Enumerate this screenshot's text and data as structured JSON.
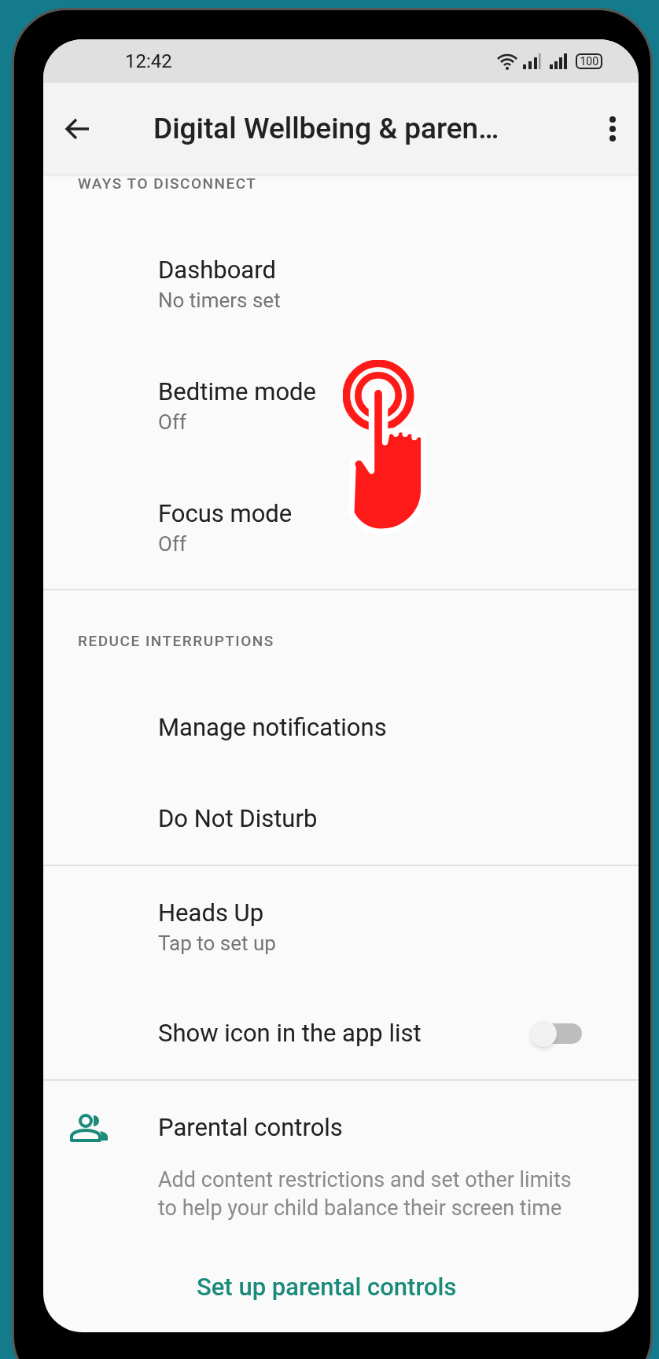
{
  "status_bar": {
    "time": "12:42",
    "battery": "100"
  },
  "app_bar": {
    "title": "Digital Wellbeing & paren…"
  },
  "sections": [
    {
      "header": "WAYS TO DISCONNECT",
      "items": [
        {
          "kind": "item",
          "title": "Dashboard",
          "subtitle": "No timers set"
        },
        {
          "kind": "item",
          "title": "Bedtime mode",
          "subtitle": "Off"
        },
        {
          "kind": "item",
          "title": "Focus mode",
          "subtitle": "Off"
        }
      ]
    },
    {
      "header": "REDUCE INTERRUPTIONS",
      "items": [
        {
          "kind": "item",
          "title": "Manage notifications"
        },
        {
          "kind": "item",
          "title": "Do Not Disturb"
        }
      ]
    },
    {
      "items": [
        {
          "kind": "item",
          "title": "Heads Up",
          "subtitle": "Tap to set up"
        },
        {
          "kind": "toggle",
          "title": "Show icon in the app list",
          "on": false
        }
      ]
    }
  ],
  "parental": {
    "title": "Parental controls",
    "description": "Add content restrictions and set other limits to help your child balance their screen time",
    "link": "Set up parental controls"
  }
}
